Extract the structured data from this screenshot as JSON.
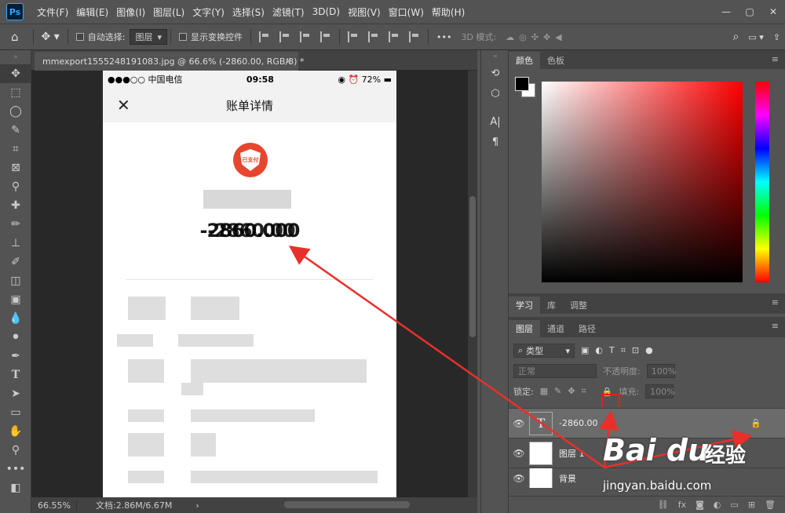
{
  "app": {
    "logo": "Ps",
    "brand_color": "#31a8ff"
  },
  "menu": [
    "文件(F)",
    "编辑(E)",
    "图像(I)",
    "图层(L)",
    "文字(Y)",
    "选择(S)",
    "滤镜(T)",
    "3D(D)",
    "视图(V)",
    "窗口(W)",
    "帮助(H)"
  ],
  "options": {
    "auto_select": "自动选择:",
    "target": "图层",
    "transform": "显示变换控件",
    "mode3d": "3D 模式:"
  },
  "doc": {
    "tab_title": "mmexport1555248191083.jpg @ 66.6% (-2860.00, RGB/8) *",
    "zoom": "66.55%",
    "size": "文档:2.86M/6.67M"
  },
  "phone": {
    "carrier": "●●●○○ 中国电信",
    "time": "09:58",
    "battery": "72%",
    "nav_title": "账单详情",
    "close": "✕",
    "amount": "-2860.00",
    "amount_behind": "-2860.000",
    "badge": "已支付"
  },
  "panels": {
    "color_tabs": [
      "颜色",
      "色板"
    ],
    "mid_tabs": [
      "学习",
      "库",
      "调整"
    ],
    "layer_tabs": [
      "图层",
      "通道",
      "路径"
    ],
    "kind": "类型",
    "blend": "正常",
    "opacity_label": "不透明度:",
    "opacity": "100%",
    "lock_label": "锁定:",
    "fill_label": "填充:",
    "fill": "100%"
  },
  "layers": [
    {
      "name": "-2860.00",
      "type": "text",
      "icon": "T"
    },
    {
      "name": "图层 1",
      "type": "image",
      "icon": ""
    },
    {
      "name": "背景",
      "type": "image",
      "icon": ""
    }
  ],
  "watermark": {
    "logo": "Bai du",
    "tag": "经验",
    "url": "jingyan.baidu.com"
  },
  "annotation_color": "#e8302b"
}
